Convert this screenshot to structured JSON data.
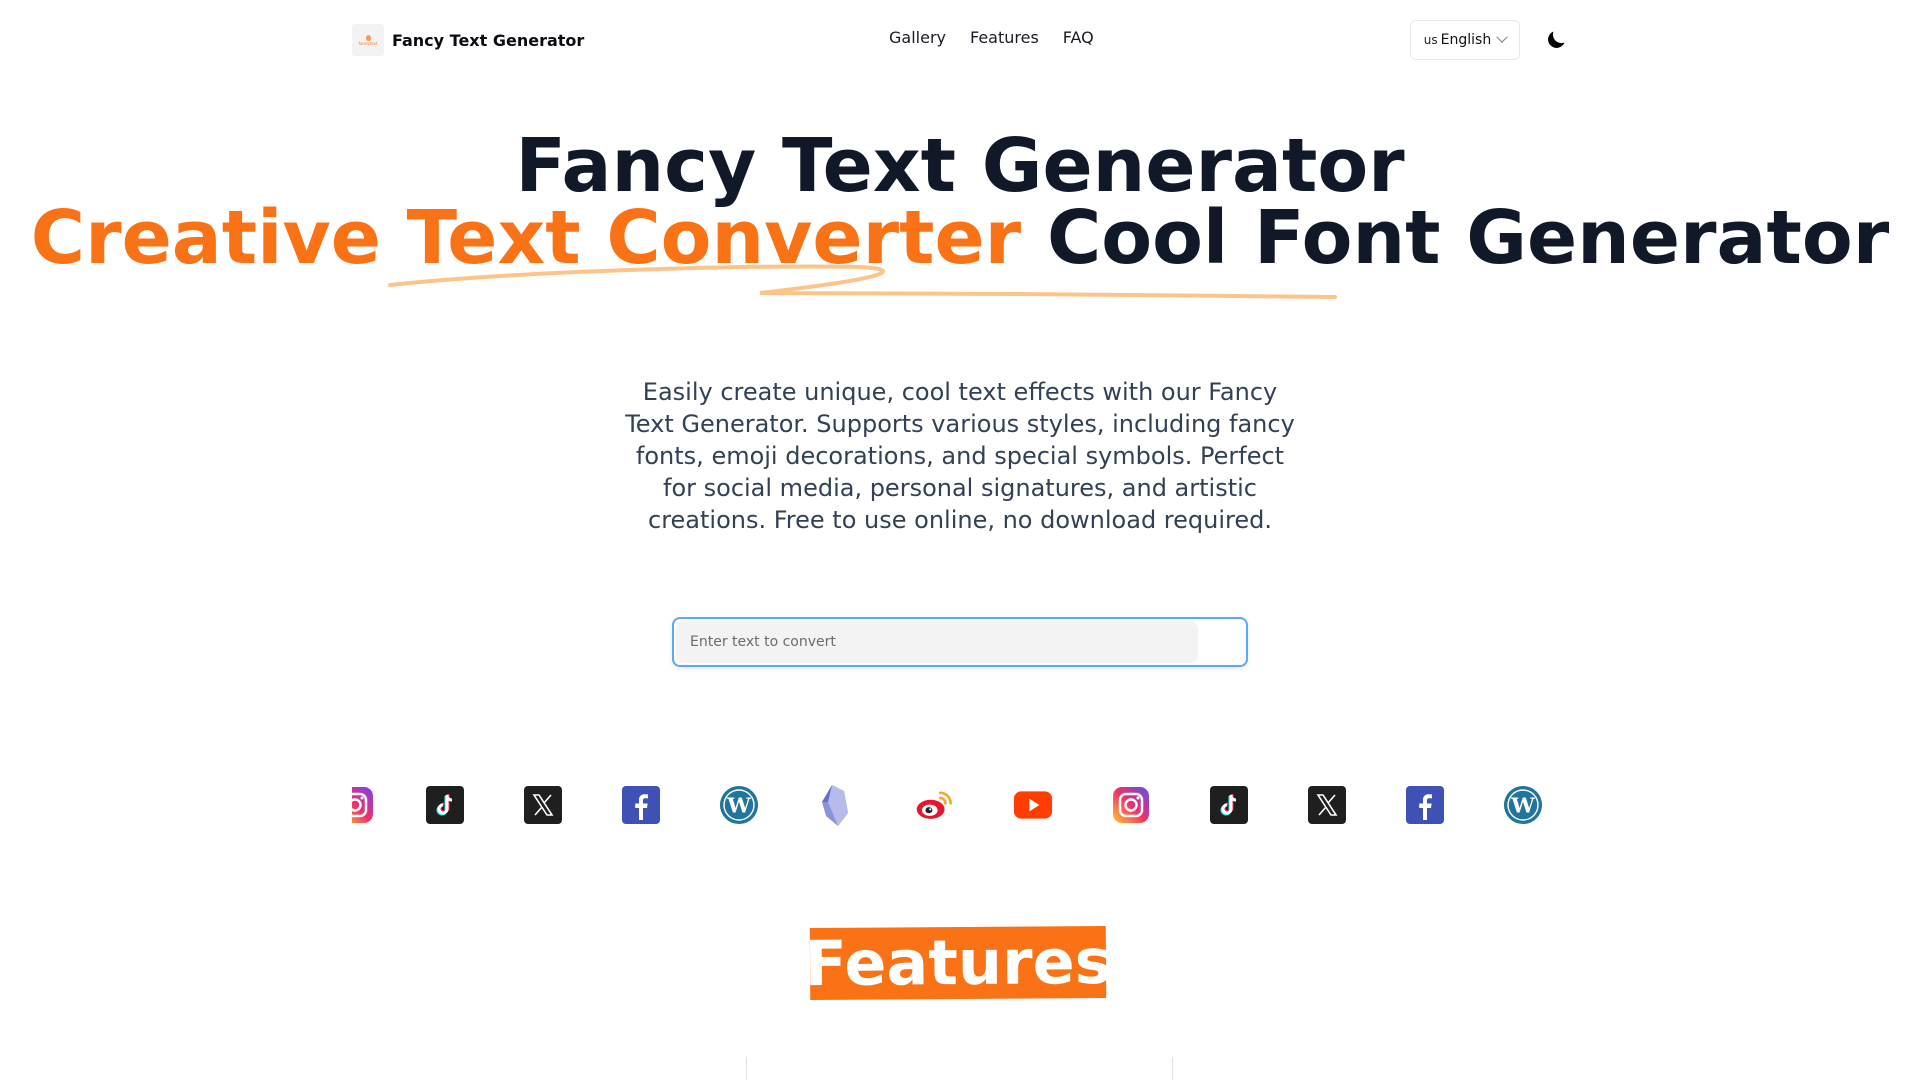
{
  "header": {
    "logo_text": "fancytext",
    "brand_name": "Fancy Text Generator",
    "nav": [
      {
        "label": "Gallery"
      },
      {
        "label": "Features"
      },
      {
        "label": "FAQ"
      }
    ],
    "language": {
      "flag": "us",
      "label": "English"
    },
    "theme_icon": "moon-icon"
  },
  "hero": {
    "title_line1": "Fancy Text Generator",
    "title_accent": "Creative Text Converter",
    "title_rest": "Cool Font Generator",
    "description": "Easily create unique, cool text effects with our Fancy Text Generator. Supports various styles, including fancy fonts, emoji decorations, and special symbols. Perfect for social media, personal signatures, and artistic creations. Free to use online, no download required.",
    "input_placeholder": "Enter text to convert",
    "input_value": ""
  },
  "colors": {
    "accent": "#f97316",
    "heading": "#111827",
    "body": "#334155",
    "input_border": "#60a5fa"
  },
  "social_icons": [
    "instagram-icon",
    "tiktok-icon",
    "x-icon",
    "facebook-icon",
    "wordpress-icon",
    "obsidian-icon",
    "weibo-icon",
    "youtube-icon",
    "instagram-icon",
    "tiktok-icon",
    "x-icon",
    "facebook-icon",
    "wordpress-icon"
  ],
  "features": {
    "heading": "Features"
  }
}
